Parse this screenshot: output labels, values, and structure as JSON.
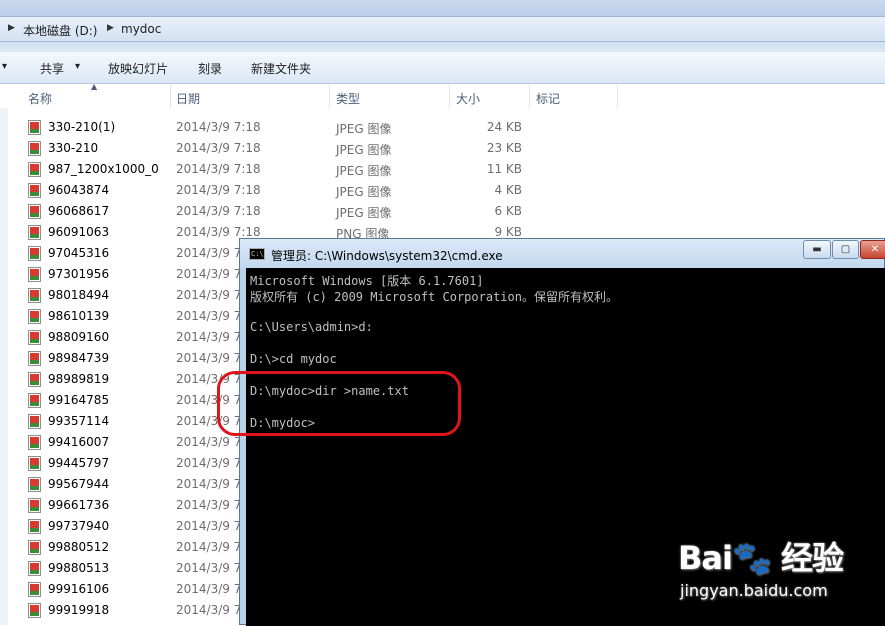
{
  "explorer": {
    "breadcrumb": [
      "本地磁盘 (D:)",
      "mydoc"
    ],
    "toolbar": {
      "share": "共享",
      "slideshow": "放映幻灯片",
      "burn": "刻录",
      "new_folder": "新建文件夹"
    },
    "columns": {
      "name": "名称",
      "date": "日期",
      "type": "类型",
      "size": "大小",
      "tags": "标记"
    },
    "files": [
      {
        "name": "330-210(1)",
        "date": "2014/3/9 7:18",
        "type": "JPEG 图像",
        "size": "24 KB"
      },
      {
        "name": "330-210",
        "date": "2014/3/9 7:18",
        "type": "JPEG 图像",
        "size": "23 KB"
      },
      {
        "name": "987_1200x1000_0",
        "date": "2014/3/9 7:18",
        "type": "JPEG 图像",
        "size": "11 KB"
      },
      {
        "name": "96043874",
        "date": "2014/3/9 7:18",
        "type": "JPEG 图像",
        "size": "4 KB"
      },
      {
        "name": "96068617",
        "date": "2014/3/9 7:18",
        "type": "JPEG 图像",
        "size": "6 KB"
      },
      {
        "name": "96091063",
        "date": "2014/3/9 7:18",
        "type": "PNG 图像",
        "size": "9 KB"
      },
      {
        "name": "97045316",
        "date": "2014/3/9 7",
        "type": "",
        "size": ""
      },
      {
        "name": "97301956",
        "date": "2014/3/9 7",
        "type": "",
        "size": ""
      },
      {
        "name": "98018494",
        "date": "2014/3/9 7",
        "type": "",
        "size": ""
      },
      {
        "name": "98610139",
        "date": "2014/3/9 7",
        "type": "",
        "size": ""
      },
      {
        "name": "98809160",
        "date": "2014/3/9 7",
        "type": "",
        "size": ""
      },
      {
        "name": "98984739",
        "date": "2014/3/9 7",
        "type": "",
        "size": ""
      },
      {
        "name": "98989819",
        "date": "2014/3/9 7",
        "type": "",
        "size": ""
      },
      {
        "name": "99164785",
        "date": "2014/3/9 7",
        "type": "",
        "size": ""
      },
      {
        "name": "99357114",
        "date": "2014/3/9 7",
        "type": "",
        "size": ""
      },
      {
        "name": "99416007",
        "date": "2014/3/9 7",
        "type": "",
        "size": ""
      },
      {
        "name": "99445797",
        "date": "2014/3/9 7",
        "type": "",
        "size": ""
      },
      {
        "name": "99567944",
        "date": "2014/3/9 7",
        "type": "",
        "size": ""
      },
      {
        "name": "99661736",
        "date": "2014/3/9 7",
        "type": "",
        "size": ""
      },
      {
        "name": "99737940",
        "date": "2014/3/9 7",
        "type": "",
        "size": ""
      },
      {
        "name": "99880512",
        "date": "2014/3/9 7",
        "type": "",
        "size": ""
      },
      {
        "name": "99880513",
        "date": "2014/3/9 7",
        "type": "",
        "size": ""
      },
      {
        "name": "99916106",
        "date": "2014/3/9 7",
        "type": "",
        "size": ""
      },
      {
        "name": "99919918",
        "date": "2014/3/9 7",
        "type": "",
        "size": ""
      }
    ]
  },
  "cmd": {
    "title": "管理员: C:\\Windows\\system32\\cmd.exe",
    "icon_text": "C:\\",
    "lines": [
      "Microsoft Windows [版本 6.1.7601]",
      "版权所有 (c) 2009 Microsoft Corporation。保留所有权利。",
      "",
      "C:\\Users\\admin>d:",
      "",
      "D:\\>cd mydoc",
      "",
      "D:\\mydoc>dir >name.txt",
      "",
      "D:\\mydoc>"
    ]
  },
  "watermark": {
    "logo": "Bai🐾 经验",
    "url": "jingyan.baidu.com"
  },
  "colors": {
    "highlight": "#e0151c",
    "console_bg": "#000000",
    "console_text": "#c0c0c0"
  }
}
